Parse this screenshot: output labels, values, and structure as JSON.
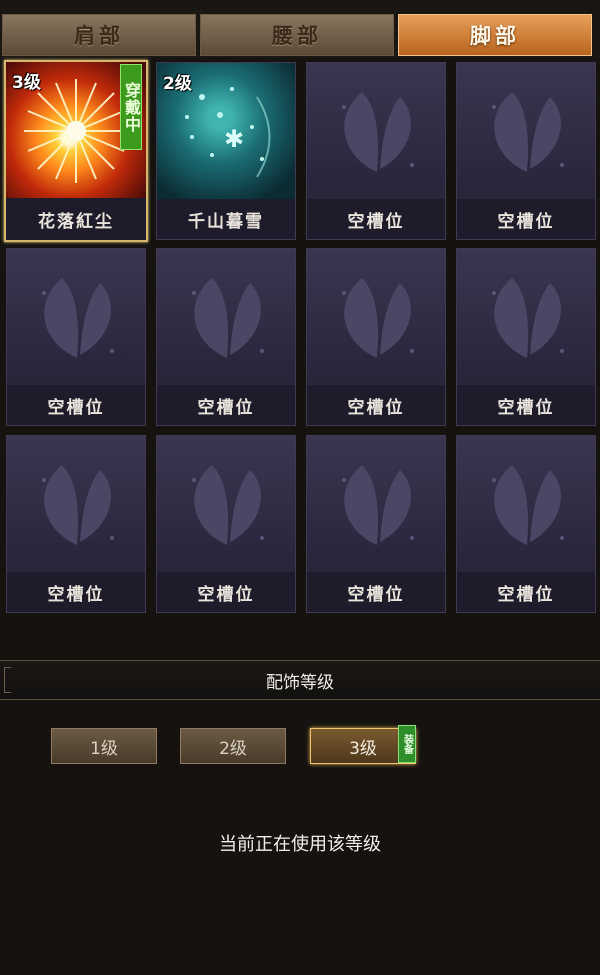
{
  "tabs": [
    {
      "label": "肩部",
      "active": false
    },
    {
      "label": "腰部",
      "active": false
    },
    {
      "label": "脚部",
      "active": true
    }
  ],
  "slots": [
    {
      "label": "花落紅尘",
      "level": "3级",
      "badge": "穿戴中",
      "art": "fire-starburst-icon"
    },
    {
      "label": "千山暮雪",
      "level": "2级",
      "art": "snow-sparkle-icon"
    },
    {
      "label": "空槽位",
      "art": "butterfly-placeholder-icon"
    },
    {
      "label": "空槽位",
      "art": "butterfly-placeholder-icon"
    },
    {
      "label": "空槽位",
      "art": "butterfly-placeholder-icon"
    },
    {
      "label": "空槽位",
      "art": "butterfly-placeholder-icon"
    },
    {
      "label": "空槽位",
      "art": "butterfly-placeholder-icon"
    },
    {
      "label": "空槽位",
      "art": "butterfly-placeholder-icon"
    },
    {
      "label": "空槽位",
      "art": "butterfly-placeholder-icon"
    },
    {
      "label": "空槽位",
      "art": "butterfly-placeholder-icon"
    },
    {
      "label": "空槽位",
      "art": "butterfly-placeholder-icon"
    },
    {
      "label": "空槽位",
      "art": "butterfly-placeholder-icon"
    }
  ],
  "level_section": {
    "title": "配饰等级",
    "buttons": [
      {
        "label": "1级",
        "active": false
      },
      {
        "label": "2级",
        "active": false
      },
      {
        "label": "3级",
        "active": true
      }
    ],
    "equip_badge": "装备",
    "status_text": "当前正在使用该等级"
  },
  "colors": {
    "active_tab": "#d4843a",
    "worn_badge": "#3c9a1c",
    "slot_bg": "#2c2940",
    "selected_border": "#d7b76b"
  }
}
